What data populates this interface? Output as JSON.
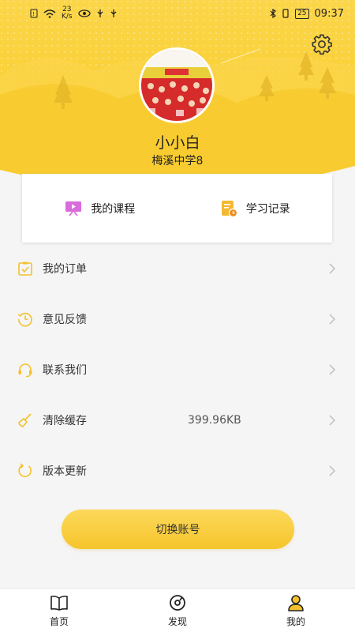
{
  "status_bar": {
    "net_speed_value": "23",
    "net_speed_unit": "K/s",
    "battery": "25",
    "time": "09:37"
  },
  "profile": {
    "username": "小小白",
    "school": "梅溪中学8"
  },
  "quick_links": [
    {
      "label": "我的课程",
      "icon": "course-screen-icon"
    },
    {
      "label": "学习记录",
      "icon": "study-record-icon"
    }
  ],
  "menu": [
    {
      "label": "我的订单",
      "icon": "order-clipboard-icon",
      "value": ""
    },
    {
      "label": "意见反馈",
      "icon": "feedback-clock-icon",
      "value": ""
    },
    {
      "label": "联系我们",
      "icon": "headset-icon",
      "value": ""
    },
    {
      "label": "清除缓存",
      "icon": "clear-cache-icon",
      "value": "399.96KB"
    },
    {
      "label": "版本更新",
      "icon": "refresh-icon",
      "value": ""
    }
  ],
  "switch_account_label": "切换账号",
  "tabs": [
    {
      "label": "首页",
      "icon": "book-icon"
    },
    {
      "label": "发现",
      "icon": "discover-icon"
    },
    {
      "label": "我的",
      "icon": "person-icon"
    }
  ],
  "colors": {
    "accent": "#f8c91e",
    "icon_yellow": "#f3c12a",
    "background": "#f5f5f5"
  }
}
